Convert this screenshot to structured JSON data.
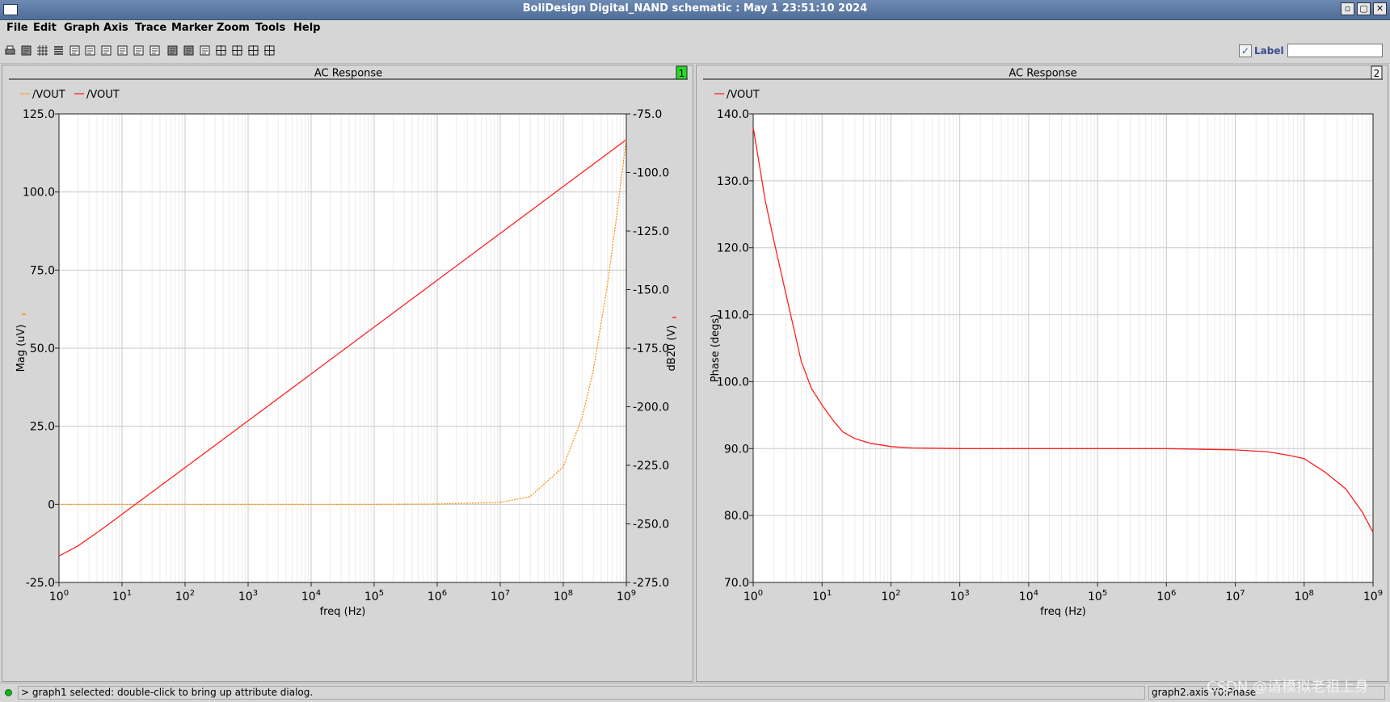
{
  "window": {
    "title": "BoliDesign Digital_NAND schematic : May  1 23:51:10 2024",
    "min_glyph": "▫",
    "max_glyph": "▢",
    "close_glyph": "✕"
  },
  "menu": [
    "File",
    "Edit",
    "Graph",
    "Axis",
    "Trace",
    "Marker",
    "Zoom",
    "Tools",
    "Help"
  ],
  "toolbar": {
    "icons": [
      "print-icon",
      "print-preview-icon",
      "grid-icon",
      "stack-icon",
      "overlay-icon",
      "split-icon",
      "add-strip-icon",
      "delete-strip-icon",
      "move-strip-icon",
      "label-icon",
      "color-icon",
      "hatch-icon",
      "calculator-icon",
      "zoom-fit-icon",
      "zoom-x-icon",
      "zoom-y-icon",
      "zoom-box-icon"
    ],
    "label_checked": true,
    "label_text": "Label",
    "label_value": ""
  },
  "graphs": [
    {
      "title": "AC Response",
      "number": "1",
      "selected": true,
      "legend": [
        {
          "name": "/VOUT",
          "color": "#ff8c00",
          "style": "dashed"
        },
        {
          "name": "/VOUT",
          "color": "#ff2020",
          "style": "solid"
        }
      ],
      "xlabel": "freq (Hz)",
      "xticks": [
        "10^0",
        "10^1",
        "10^2",
        "10^3",
        "10^4",
        "10^5",
        "10^6",
        "10^7",
        "10^8",
        "10^9"
      ],
      "left_axis": {
        "label": "Mag (uV)",
        "ticks": [
          "125.0",
          "100.0",
          "75.0",
          "50.0",
          "25.0",
          "0",
          "-25.0"
        ],
        "range": [
          -25,
          125
        ],
        "marker_color": "#ff8c00"
      },
      "right_axis": {
        "label": "dB20 (V)",
        "ticks": [
          "-75.0",
          "-100.0",
          "-125.0",
          "-150.0",
          "-175.0",
          "-200.0",
          "-225.0",
          "-250.0",
          "-275.0"
        ],
        "range": [
          -275,
          -75
        ],
        "marker_color": "#ff2020"
      }
    },
    {
      "title": "AC Response",
      "number": "2",
      "selected": false,
      "legend": [
        {
          "name": "/VOUT",
          "color": "#ff2020",
          "style": "solid"
        }
      ],
      "xlabel": "freq (Hz)",
      "xticks": [
        "10^0",
        "10^1",
        "10^2",
        "10^3",
        "10^4",
        "10^5",
        "10^6",
        "10^7",
        "10^8",
        "10^9"
      ],
      "left_axis": {
        "label": "Phase (degs)",
        "ticks": [
          "140.0",
          "130.0",
          "120.0",
          "110.0",
          "100.0",
          "90.0",
          "80.0",
          "70.0"
        ],
        "range": [
          70,
          140
        ]
      }
    }
  ],
  "chart_data": [
    {
      "type": "line",
      "title": "AC Response",
      "xlabel": "freq (Hz)",
      "ylabel": "Mag (uV)",
      "y2label": "dB20 (V)",
      "x_scale": "log",
      "xlim": [
        1,
        1000000000
      ],
      "ylim": [
        -25,
        125
      ],
      "y2lim": [
        -275,
        -75
      ],
      "grid": true,
      "legend_position": "top-left",
      "series": [
        {
          "name": "/VOUT",
          "axis": "left",
          "color": "#ff8c00",
          "style": "dashed",
          "x": [
            1,
            10,
            100,
            1000,
            10000,
            100000,
            1000000,
            10000000,
            30000000,
            100000000,
            200000000,
            300000000,
            500000000,
            700000000,
            1000000000
          ],
          "y": [
            0,
            0,
            0,
            0,
            0,
            0,
            0.1,
            0.6,
            2.5,
            12,
            28,
            43,
            70,
            92,
            117
          ]
        },
        {
          "name": "/VOUT",
          "axis": "right",
          "color": "#ff2020",
          "style": "solid",
          "x": [
            1,
            2,
            5,
            10,
            100,
            1000,
            10000,
            100000,
            1000000,
            10000000,
            100000000,
            1000000000
          ],
          "y": [
            -263.7,
            -259.4,
            -251.9,
            -245.9,
            -226,
            -206,
            -186,
            -166,
            -146,
            -126,
            -106,
            -86
          ]
        }
      ]
    },
    {
      "type": "line",
      "title": "AC Response",
      "xlabel": "freq (Hz)",
      "ylabel": "Phase (degs)",
      "x_scale": "log",
      "xlim": [
        1,
        1000000000
      ],
      "ylim": [
        70,
        140
      ],
      "grid": true,
      "legend_position": "top-left",
      "series": [
        {
          "name": "/VOUT",
          "color": "#ff2020",
          "style": "solid",
          "x": [
            1,
            1.5,
            2,
            3,
            5,
            7,
            10,
            15,
            20,
            30,
            50,
            100,
            200,
            1000,
            10000,
            100000,
            1000000,
            10000000,
            30000000,
            60000000,
            100000000,
            200000000,
            400000000,
            700000000,
            1000000000
          ],
          "y": [
            138,
            127,
            121,
            113,
            103,
            99,
            96.5,
            94,
            92.5,
            91.5,
            90.8,
            90.3,
            90.1,
            90,
            90,
            90,
            90,
            89.8,
            89.5,
            89,
            88.5,
            86.5,
            84,
            80.5,
            77.5
          ]
        }
      ]
    }
  ],
  "status": {
    "message": "> graph1 selected: double-click to bring up attribute dialog.",
    "right_text": "graph2.axis Y0:Phase",
    "watermark": "CSDN @请模拟老祖上身"
  }
}
